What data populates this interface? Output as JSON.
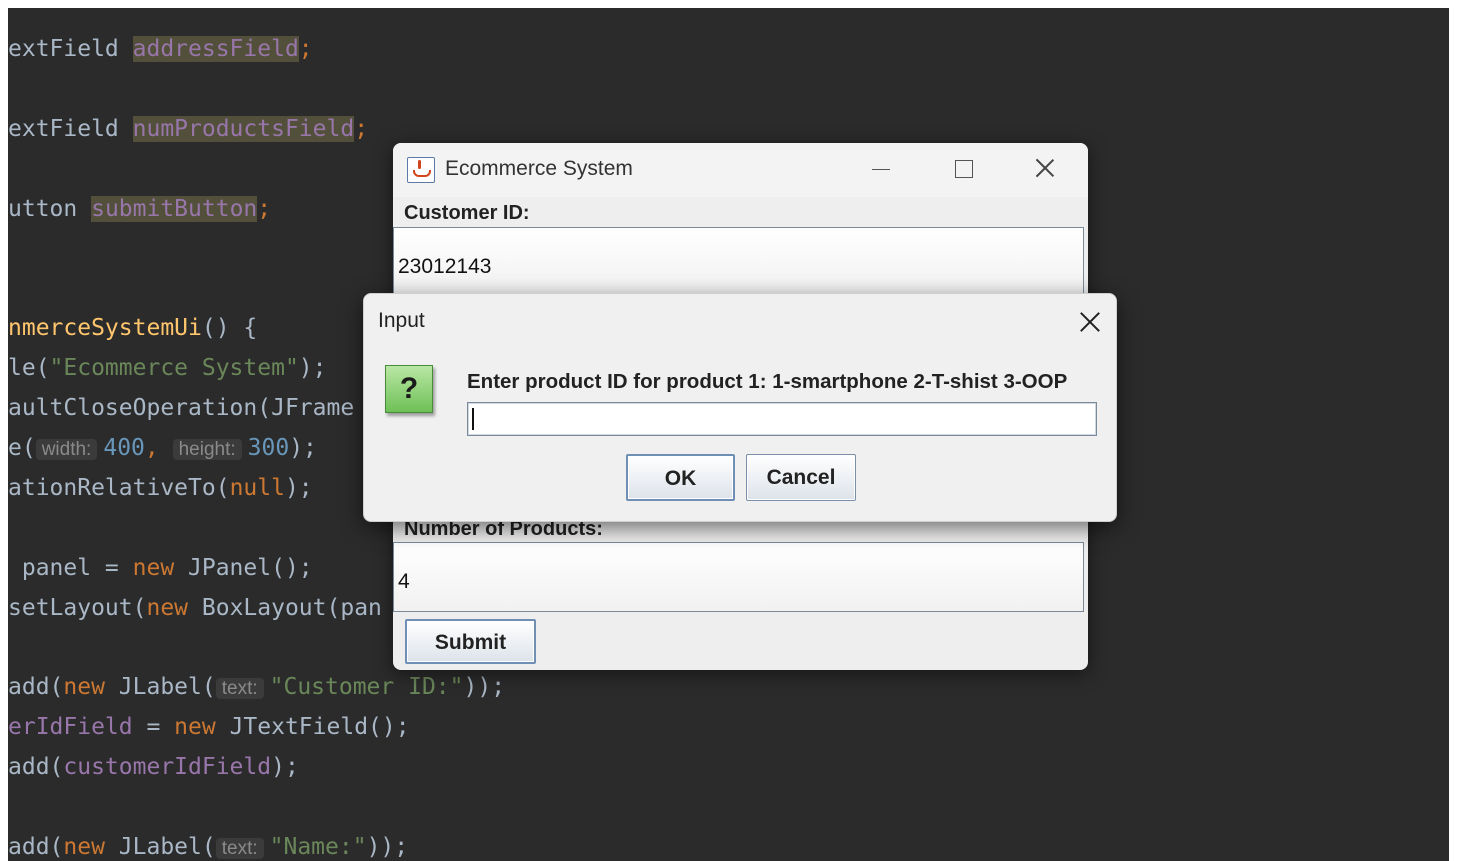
{
  "editor": {
    "lines": [
      {
        "pre": "extField ",
        "field": "addressField",
        "post": ";"
      },
      {
        "pre": "extField ",
        "field": "numProductsField",
        "post": ";"
      },
      {
        "pre": "utton ",
        "field": "submitButton",
        "post": ";"
      },
      {
        "a": "nmerceSystemUi",
        "b": "() {"
      },
      {
        "a": "le(",
        "s": "\"Ecommerce System\"",
        "b": ");"
      },
      {
        "a": "aultCloseOperation(JFrame"
      },
      {
        "a": "e(",
        "hint1": "width:",
        "n1": "400",
        "c": ", ",
        "hint2": "height:",
        "n2": "300",
        "b": ");"
      },
      {
        "a": "ationRelativeTo(",
        "k": "null",
        "b": ");"
      },
      {
        "a": " panel = ",
        "k": "new",
        "b": " JPanel();"
      },
      {
        "a": "setLayout(",
        "k": "new",
        "b": " BoxLayout(pan"
      },
      {
        "a": "add(",
        "k": "new",
        "b": " JLabel(",
        "hint": "text:",
        "s": "\"Customer ID:\"",
        "c": "));"
      },
      {
        "f": "erIdField",
        "a": " = ",
        "k": "new",
        "b": " JTextField();"
      },
      {
        "a": "add(",
        "f": "customerIdField",
        "b": ");"
      },
      {
        "a": "add(",
        "k": "new",
        "b": " JLabel(",
        "hint": "text:",
        "s": "\"Name:\"",
        "c": "));"
      }
    ]
  },
  "main_window": {
    "title": "Ecommerce System",
    "customer_id_label": "Customer ID:",
    "customer_id_value": "23012143",
    "num_products_label": "Number of Products:",
    "num_products_value": "4",
    "submit_label": "Submit"
  },
  "dialog": {
    "title": "Input",
    "prompt": "Enter product ID for product 1: 1-smartphone  2-T-shist 3-OOP",
    "input_value": "",
    "ok_label": "OK",
    "cancel_label": "Cancel",
    "icon": "question-icon"
  }
}
